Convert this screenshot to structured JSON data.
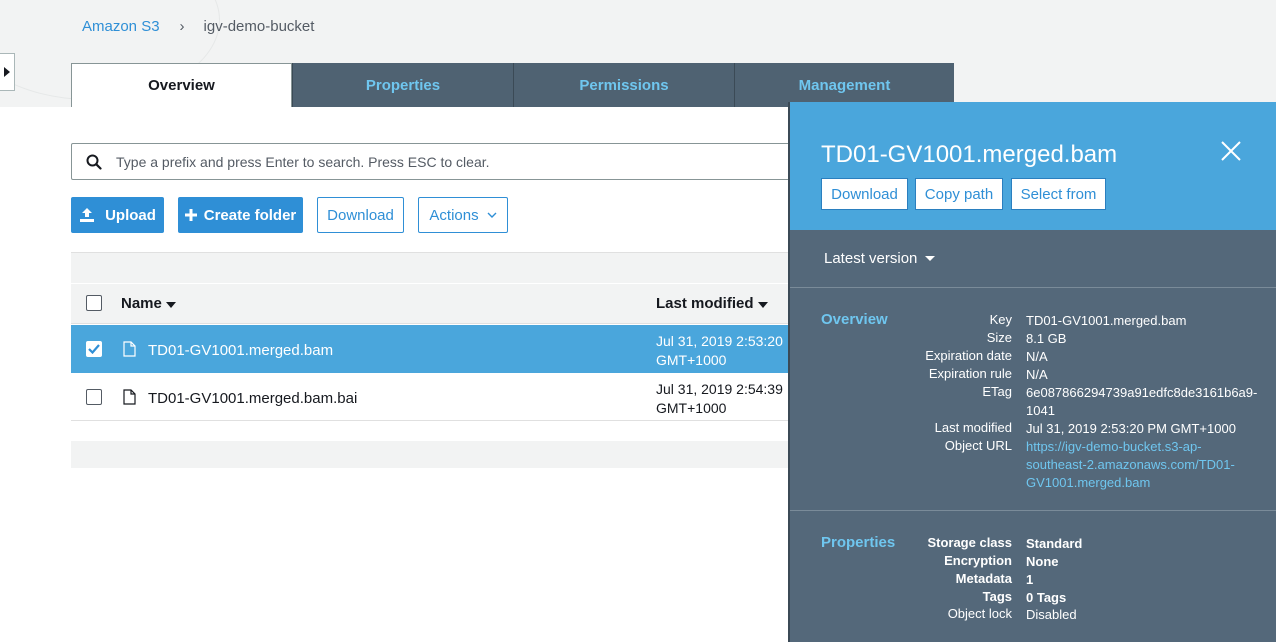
{
  "breadcrumb": {
    "root": "Amazon S3",
    "separator": "›",
    "current": "igv-demo-bucket"
  },
  "tabs": [
    {
      "label": "Overview"
    },
    {
      "label": "Properties"
    },
    {
      "label": "Permissions"
    },
    {
      "label": "Management"
    }
  ],
  "search": {
    "placeholder": "Type a prefix and press Enter to search. Press ESC to clear."
  },
  "toolbar": {
    "upload_label": "Upload",
    "create_folder_label": "Create folder",
    "download_label": "Download",
    "actions_label": "Actions"
  },
  "table": {
    "columns": {
      "name": "Name",
      "last_modified": "Last modified"
    },
    "rows": [
      {
        "name": "TD01-GV1001.merged.bam",
        "date_line1": "Jul 31, 2019 2:53:20",
        "date_line2": "GMT+1000",
        "selected": true
      },
      {
        "name": "TD01-GV1001.merged.bam.bai",
        "date_line1": "Jul 31, 2019 2:54:39",
        "date_line2": "GMT+1000",
        "selected": false
      }
    ]
  },
  "panel": {
    "title": "TD01-GV1001.merged.bam",
    "buttons": {
      "download": "Download",
      "copy_path": "Copy path",
      "select_from": "Select from"
    },
    "version_label": "Latest version",
    "overview": {
      "heading": "Overview",
      "key_label": "Key",
      "key_value": "TD01-GV1001.merged.bam",
      "size_label": "Size",
      "size_value": "8.1 GB",
      "expiration_date_label": "Expiration date",
      "expiration_date_value": "N/A",
      "expiration_rule_label": "Expiration rule",
      "expiration_rule_value": "N/A",
      "etag_label": "ETag",
      "etag_line1": "6e087866294739a91edfc8de3161b6a9-",
      "etag_line2": "1041",
      "last_modified_label": "Last modified",
      "last_modified_value": "Jul 31, 2019 2:53:20 PM GMT+1000",
      "object_url_label": "Object URL",
      "object_url_line1": "https://igv-demo-bucket.s3-ap-",
      "object_url_line2": "southeast-2.amazonaws.com/TD01-",
      "object_url_line3": "GV1001.merged.bam"
    },
    "properties": {
      "heading": "Properties",
      "storage_class_label": "Storage class",
      "storage_class_value": "Standard",
      "encryption_label": "Encryption",
      "encryption_value": "None",
      "metadata_label": "Metadata",
      "metadata_value": "1",
      "tags_label": "Tags",
      "tags_value": "0 Tags",
      "object_lock_label": "Object lock",
      "object_lock_value": "Disabled"
    }
  },
  "colors": {
    "accent": "#2f8fd6",
    "selected_row": "#4aa6dc",
    "panel_bg": "#54687a",
    "tab_dark": "#4f6272"
  }
}
